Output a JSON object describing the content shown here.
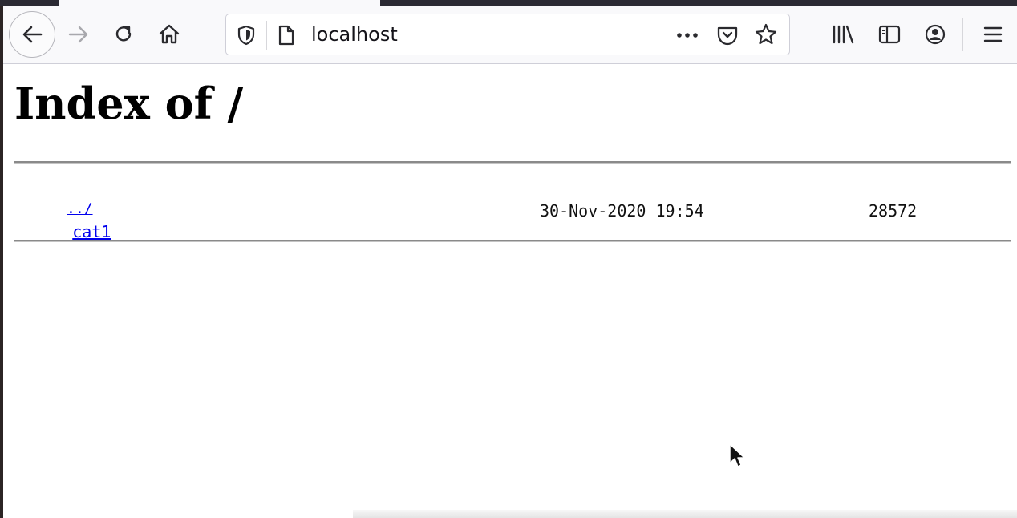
{
  "browser": {
    "url": "localhost",
    "icons": {
      "back": "back-arrow-icon",
      "forward": "forward-arrow-icon",
      "reload": "reload-icon",
      "home": "home-icon",
      "tracking": "shield-icon",
      "page": "page-icon",
      "page_actions": "more-dots-icon",
      "pocket": "pocket-icon",
      "bookmark": "star-icon",
      "library": "library-icon",
      "sidebar": "sidebar-icon",
      "account": "account-icon",
      "menu": "hamburger-menu-icon"
    }
  },
  "page": {
    "title": "Index of /",
    "entries": [
      {
        "name": "../",
        "date": "",
        "size": ""
      },
      {
        "name": "cat1",
        "date": "30-Nov-2020 19:54",
        "size": "28572"
      }
    ]
  },
  "colors": {
    "link": "#0000ee",
    "toolbar_bg": "#f9f9fb",
    "rule": "#8a8a8a"
  }
}
